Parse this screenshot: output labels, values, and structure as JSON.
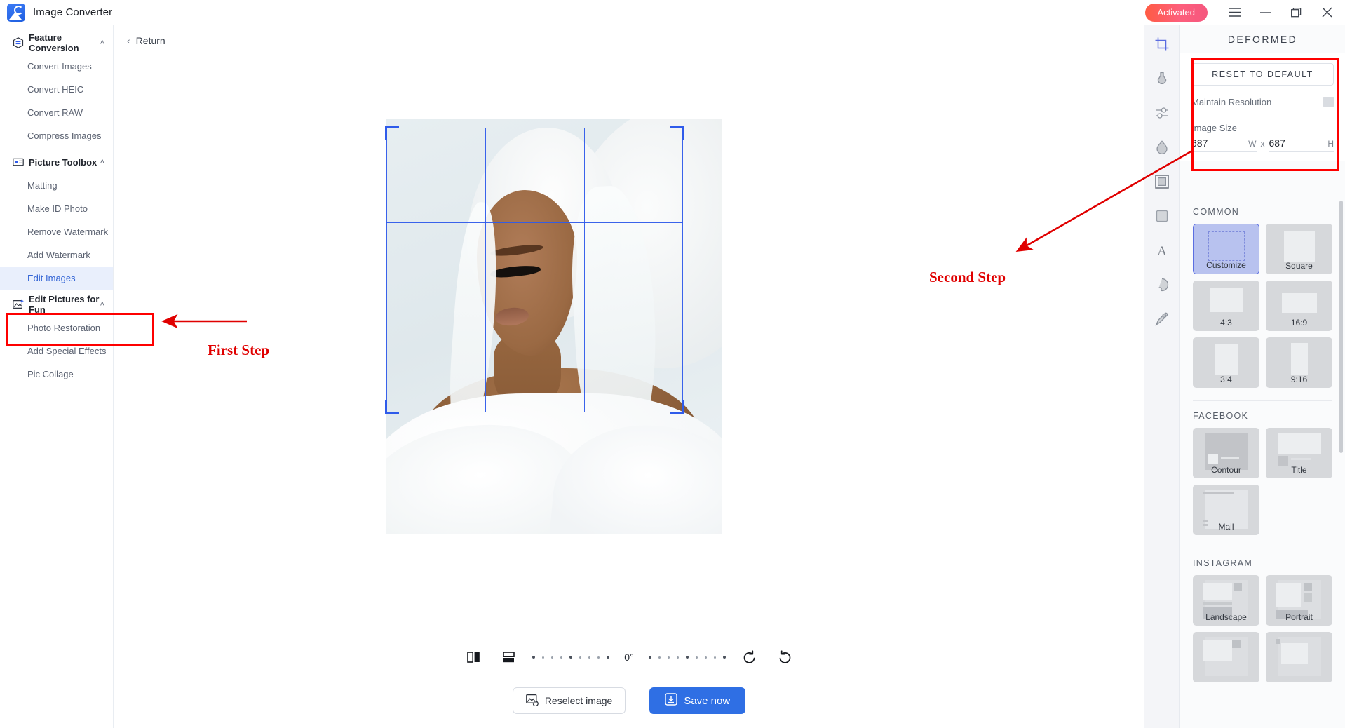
{
  "titlebar": {
    "app_title": "Image Converter",
    "activated_label": "Activated",
    "logo_icon": "image-converter-logo",
    "menu_icon": "hamburger-menu-icon",
    "minimize_icon": "minimize-icon",
    "maximize_icon": "maximize-icon",
    "close_icon": "close-icon"
  },
  "sidebar": {
    "groups": [
      {
        "label": "Feature Conversion",
        "icon": "conversion-icon",
        "chevron": "˄",
        "items": [
          {
            "label": "Convert Images"
          },
          {
            "label": "Convert HEIC"
          },
          {
            "label": "Convert RAW"
          },
          {
            "label": "Compress Images"
          }
        ]
      },
      {
        "label": "Picture Toolbox",
        "icon": "toolbox-icon",
        "chevron": "˄",
        "items": [
          {
            "label": "Matting"
          },
          {
            "label": "Make ID Photo"
          },
          {
            "label": "Remove Watermark"
          },
          {
            "label": "Add Watermark"
          },
          {
            "label": "Edit Images",
            "selected": true
          }
        ]
      },
      {
        "label": "Edit Pictures for Fun",
        "icon": "fun-picture-icon",
        "chevron": "˄",
        "items": [
          {
            "label": "Photo Restoration"
          },
          {
            "label": "Add Special Effects"
          },
          {
            "label": "Pic Collage"
          }
        ]
      }
    ]
  },
  "main": {
    "return_label": "Return",
    "rotation": {
      "flip_horizontal_icon": "flip-horizontal-icon",
      "flip_vertical_icon": "flip-vertical-icon",
      "angle_value": "0°",
      "rotate_left_icon": "rotate-left-icon",
      "rotate_right_icon": "rotate-right-icon"
    },
    "actions": {
      "reselect_label": "Reselect image",
      "reselect_icon": "reselect-image-icon",
      "save_label": "Save now",
      "save_icon": "save-download-icon"
    }
  },
  "rail": {
    "items": [
      {
        "icon": "crop-icon",
        "active": true
      },
      {
        "icon": "flask-adjust-icon",
        "active": false
      },
      {
        "icon": "levels-sliders-icon",
        "active": false
      },
      {
        "icon": "droplet-blur-icon",
        "active": false
      },
      {
        "icon": "frame-border-icon",
        "active": false
      },
      {
        "icon": "square-shape-icon",
        "active": false
      },
      {
        "icon": "text-tool-icon",
        "active": false
      },
      {
        "icon": "palette-icon",
        "active": false
      },
      {
        "icon": "signature-pen-icon",
        "active": false
      }
    ]
  },
  "right_panel": {
    "title": "DEFORMED",
    "reset_label": "RESET TO DEFAULT",
    "maintain_resolution_label": "Maintain Resolution",
    "maintain_resolution_checked": false,
    "image_size_label": "Image Size",
    "width_value": "687",
    "width_unit": "W",
    "multiply_symbol": "x",
    "height_value": "687",
    "height_unit": "H",
    "sections": [
      {
        "heading": "COMMON",
        "cards": [
          {
            "label": "Customize",
            "selected": true,
            "tw": 52,
            "th": 42
          },
          {
            "label": "Square",
            "selected": false,
            "tw": 44,
            "th": 44
          },
          {
            "label": "4:3",
            "selected": false,
            "tw": 46,
            "th": 35
          },
          {
            "label": "16:9",
            "selected": false,
            "tw": 50,
            "th": 28
          },
          {
            "label": "3:4",
            "selected": false,
            "tw": 32,
            "th": 44
          },
          {
            "label": "9:16",
            "selected": false,
            "tw": 24,
            "th": 46
          }
        ]
      },
      {
        "heading": "FACEBOOK",
        "cards": [
          {
            "label": "Contour",
            "selected": false,
            "tw": 56,
            "th": 46
          },
          {
            "label": "Title",
            "selected": false,
            "tw": 56,
            "th": 46
          },
          {
            "label": "Mail",
            "selected": false,
            "tw": 56,
            "th": 50
          }
        ]
      },
      {
        "heading": "INSTAGRAM",
        "cards": [
          {
            "label": "Landscape",
            "selected": false,
            "tw": 56,
            "th": 48
          },
          {
            "label": "Portrait",
            "selected": false,
            "tw": 56,
            "th": 52
          },
          {
            "label": "",
            "selected": false,
            "tw": 56,
            "th": 48
          },
          {
            "label": "",
            "selected": false,
            "tw": 56,
            "th": 48
          }
        ]
      }
    ]
  },
  "annotations": {
    "first_step": "First Step",
    "second_step": "Second Step",
    "highlight_color": "#fe0000",
    "text_color": "#e00000"
  }
}
